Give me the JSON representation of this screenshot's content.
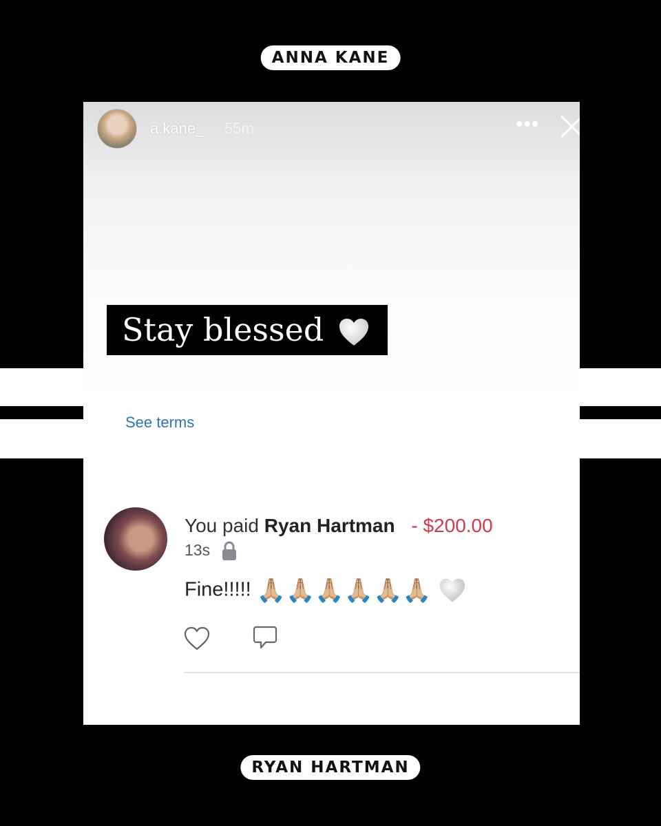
{
  "labels": {
    "top": "ANNA KANE",
    "bottom": "RYAN HARTMAN"
  },
  "story": {
    "username": "a.kane_",
    "time": "55m",
    "more": "•••",
    "caption": "Stay blessed"
  },
  "terms_link": "See terms",
  "payment": {
    "prefix": "You paid",
    "recipient": "Ryan Hartman",
    "amount": "- $200.00",
    "elapsed": "13s",
    "message": "Fine!!!!!",
    "emoji": "🙏🏼🙏🏼🙏🏼🙏🏼🙏🏼🙏🏼"
  },
  "colors": {
    "amount": "#d13a4a",
    "link": "#2d74b8",
    "background": "#000000"
  },
  "icons": [
    "white-heart-icon",
    "lock-icon",
    "like-icon",
    "comment-icon",
    "close-icon",
    "more-icon"
  ]
}
